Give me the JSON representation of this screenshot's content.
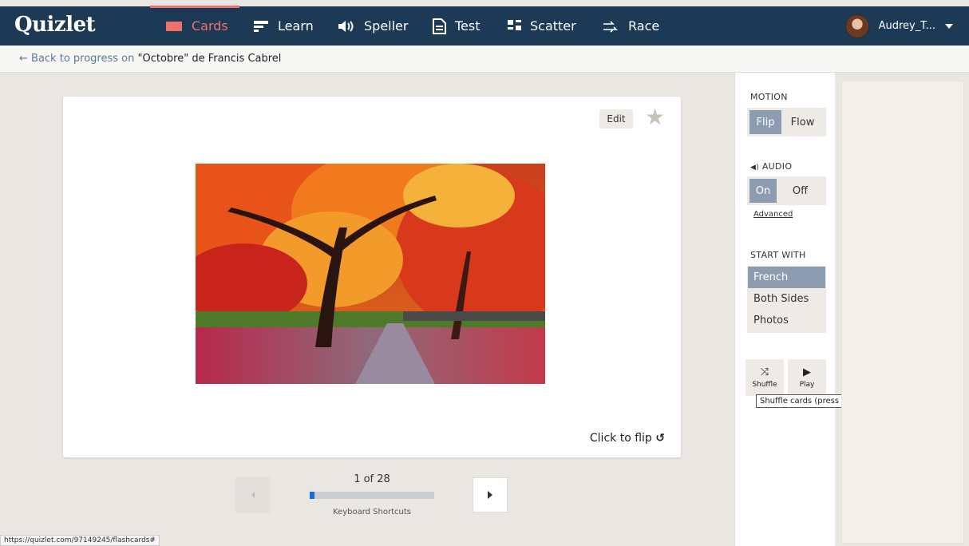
{
  "brand": "Quizlet",
  "nav": {
    "cards": "Cards",
    "learn": "Learn",
    "speller": "Speller",
    "test": "Test",
    "scatter": "Scatter",
    "race": "Race"
  },
  "user": {
    "name": "Audrey_T..."
  },
  "subbar": {
    "back_text": "← Back to progress on ",
    "set_title": "\"Octobre\" de Francis Cabrel"
  },
  "card": {
    "edit_label": "Edit",
    "flip_hint": "Click to flip"
  },
  "controls": {
    "counter": "1 of 28",
    "progress": 0.036,
    "shortcuts": "Keyboard Shortcuts"
  },
  "panel": {
    "motion_title": "MOTION",
    "motion_options": [
      "Flip",
      "Flow"
    ],
    "motion_selected": "Flip",
    "audio_title": "AUDIO",
    "audio_options": [
      "On",
      "Off"
    ],
    "audio_selected": "On",
    "advanced": "Advanced",
    "start_title": "START WITH",
    "start_options": [
      "French",
      "Both Sides",
      "Photos"
    ],
    "start_selected": "French",
    "shuffle_label": "Shuffle",
    "play_label": "Play",
    "shuffle_tooltip": "Shuffle cards (press H)"
  },
  "status_url": "https://quizlet.com/97149245/flashcards#",
  "colors": {
    "nav_bg": "#1c3a55",
    "active": "#ef6f6c",
    "selected": "#8d9db1",
    "progress": "#1f6ad3"
  }
}
